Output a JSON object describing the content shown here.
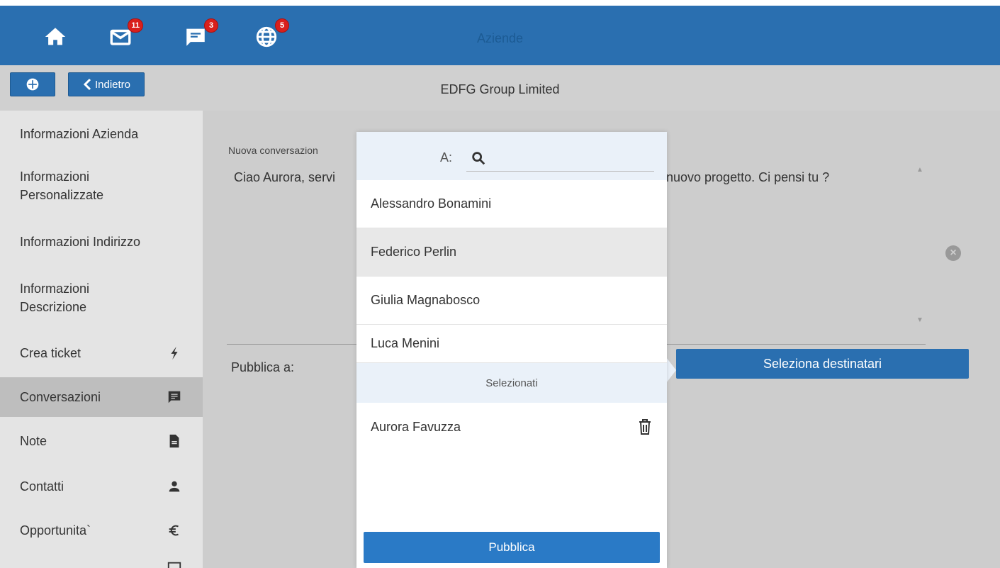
{
  "header": {
    "title": "Aziende",
    "badges": {
      "mail": "11",
      "chat": "3",
      "globe": "5"
    }
  },
  "subbar": {
    "back_label": "Indietro",
    "company": "EDFG Group Limited"
  },
  "sidebar": {
    "items": [
      {
        "label": "Informazioni Azienda"
      },
      {
        "label": "Informazioni\nPersonalizzate"
      },
      {
        "label": "Informazioni Indirizzo"
      },
      {
        "label": "Informazioni\nDescrizione"
      },
      {
        "label": "Crea ticket",
        "icon": "lightning-icon"
      },
      {
        "label": "Conversazioni",
        "icon": "chat-icon"
      },
      {
        "label": "Note",
        "icon": "document-icon"
      },
      {
        "label": "Contatti",
        "icon": "person-icon"
      },
      {
        "label": "Opportunita`",
        "icon": "euro-icon"
      }
    ]
  },
  "main": {
    "nuova_label": "Nuova conversazion",
    "message_left": "Ciao Aurora, servi",
    "message_right": "nuovo progetto. Ci pensi tu ?",
    "pubblica_label": "Pubblica a:",
    "select_button": "Seleziona destinatari"
  },
  "popup": {
    "to_label": "A:",
    "search_value": "",
    "contacts": [
      "Alessandro Bonamini",
      "Federico Perlin",
      "Giulia Magnabosco",
      "Luca Menini"
    ],
    "selected_header": "Selezionati",
    "selected": [
      "Aurora Favuzza"
    ],
    "publish_button": "Pubblica"
  },
  "colors": {
    "primary": "#2a6fb0",
    "badge": "#d9201c",
    "sidebar_bg": "#e4e4e4",
    "popup_head": "#eaf1f9"
  }
}
